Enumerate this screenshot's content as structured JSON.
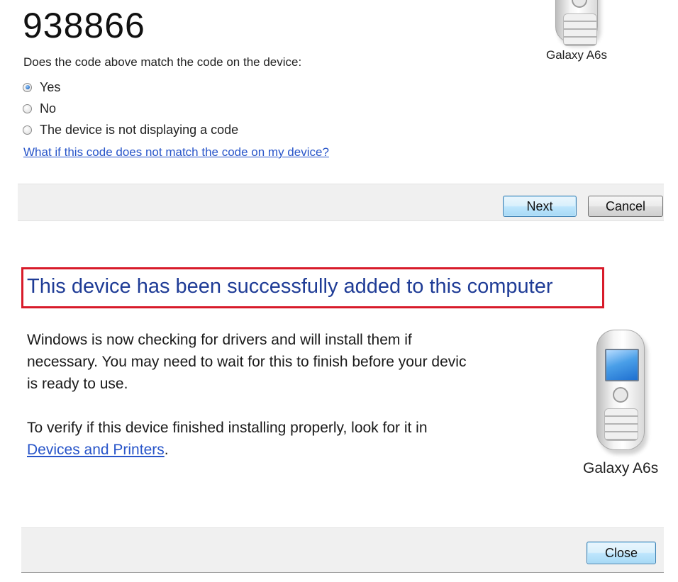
{
  "pairing": {
    "code": "938866",
    "question": "Does the code above match the code on the device:",
    "options": [
      {
        "label": "Yes",
        "selected": true
      },
      {
        "label": "No",
        "selected": false
      },
      {
        "label": "The device is not displaying a code",
        "selected": false
      }
    ],
    "help_link": "What if this code does not match the code on my device?",
    "device_name": "Galaxy A6s",
    "device_icon": "mobile-phone-icon",
    "buttons": {
      "next": "Next",
      "cancel": "Cancel"
    }
  },
  "success": {
    "title": "This device has been successfully added to this computer",
    "body_lines": [
      "Windows is now checking for drivers and will install them if",
      "necessary. You may need to wait for this to finish before your devic",
      "is ready to use."
    ],
    "verify_text": "To verify if this device finished installing properly, look for it in",
    "verify_link": "Devices and Printers",
    "verify_suffix": ".",
    "device_name": "Galaxy A6s",
    "device_icon": "mobile-phone-icon",
    "buttons": {
      "close": "Close"
    }
  },
  "colors": {
    "highlight_border": "#d81b2a",
    "title_blue": "#1f3c96",
    "link_blue": "#2855c9",
    "footer_gray": "#f0f0f0"
  }
}
